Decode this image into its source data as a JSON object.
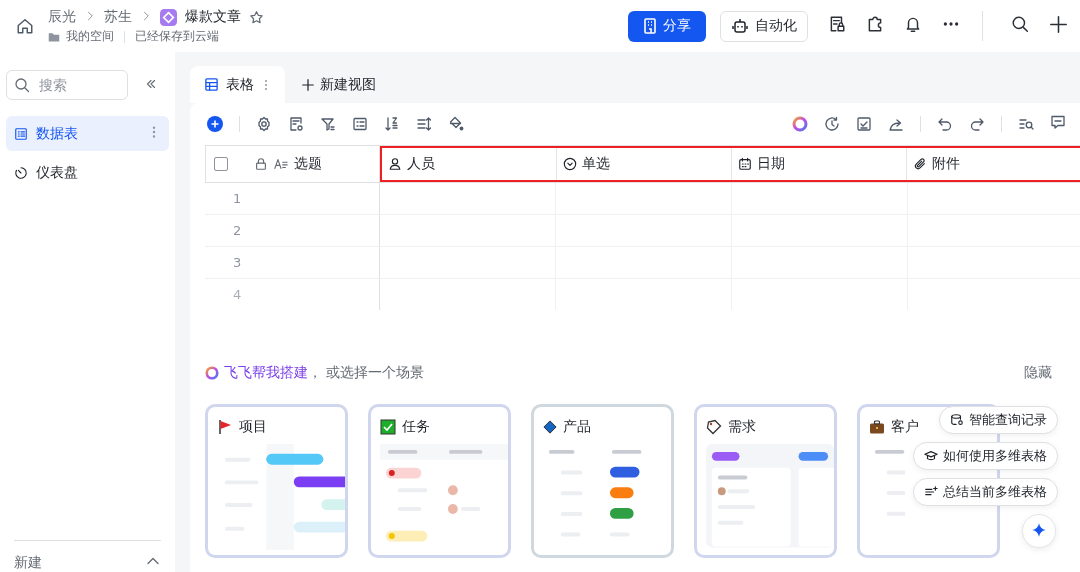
{
  "breadcrumb": {
    "items": [
      "辰光",
      "苏生"
    ],
    "doc_title": "爆款文章",
    "location": "我的空间",
    "save_status": "已经保存到云端"
  },
  "header_buttons": {
    "share": "分享",
    "automation": "自动化"
  },
  "sidebar": {
    "search_placeholder": "搜索",
    "items": [
      {
        "label": "数据表",
        "kind": "table",
        "selected": true
      },
      {
        "label": "仪表盘",
        "kind": "dashboard",
        "selected": false
      }
    ],
    "new_section": {
      "label": "新建",
      "expanded": true
    }
  },
  "view_tabs": [
    {
      "label": "表格",
      "selected": true
    }
  ],
  "new_view": "新建视图",
  "table": {
    "select_all": {
      "checked": false
    },
    "columns": [
      {
        "label": "选题",
        "kind": "text",
        "highlighted": false
      },
      {
        "label": "人员",
        "kind": "person",
        "highlighted": true
      },
      {
        "label": "单选",
        "kind": "select",
        "highlighted": true
      },
      {
        "label": "日期",
        "kind": "date",
        "highlighted": true
      },
      {
        "label": "附件",
        "kind": "attachment",
        "highlighted": true
      }
    ],
    "rows": [
      "1",
      "2",
      "3",
      "4"
    ]
  },
  "templates": {
    "ai_link": "飞飞帮我搭建",
    "prompt": "， 或选择一个场景",
    "hide": "隐藏",
    "cards": [
      {
        "title": "项目",
        "kind": "project"
      },
      {
        "title": "任务",
        "kind": "task"
      },
      {
        "title": "产品",
        "kind": "product"
      },
      {
        "title": "需求",
        "kind": "requirement"
      },
      {
        "title": "客户",
        "kind": "customer"
      }
    ]
  },
  "assistant": {
    "suggestions": [
      {
        "label": "智能查询记录",
        "kind": "query"
      },
      {
        "label": "如何使用多维表格",
        "kind": "guide"
      },
      {
        "label": "总结当前多维表格",
        "kind": "summary"
      }
    ]
  }
}
